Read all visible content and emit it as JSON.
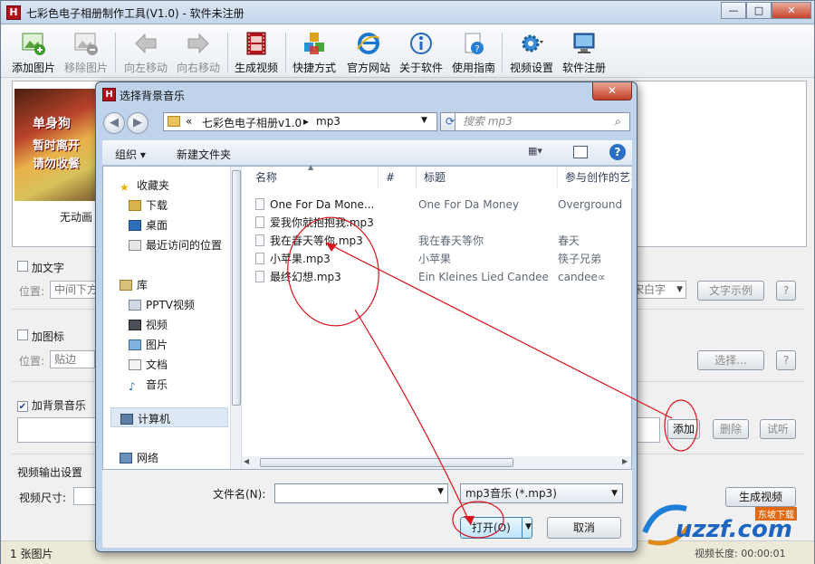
{
  "app": {
    "title": "七彩色电子相册制作工具(V1.0) - 软件未注册",
    "icon_letter": "H",
    "window_buttons": {
      "minimize": "—",
      "maximize": "□",
      "close": "✕"
    }
  },
  "toolbar": {
    "items": [
      {
        "label": "添加图片",
        "icon": "add-image-icon",
        "enabled": true
      },
      {
        "label": "移除图片",
        "icon": "remove-image-icon",
        "enabled": false
      },
      {
        "label": "向左移动",
        "icon": "arrow-left-icon",
        "enabled": false
      },
      {
        "label": "向右移动",
        "icon": "arrow-right-icon",
        "enabled": false
      },
      {
        "label": "生成视频",
        "icon": "film-icon",
        "enabled": true
      },
      {
        "label": "快捷方式",
        "icon": "cubes-icon",
        "enabled": true
      },
      {
        "label": "官方网站",
        "icon": "ie-icon",
        "enabled": true
      },
      {
        "label": "关于软件",
        "icon": "info-icon",
        "enabled": true
      },
      {
        "label": "使用指南",
        "icon": "help-doc-icon",
        "enabled": true
      },
      {
        "label": "视频设置",
        "icon": "gear-icon",
        "enabled": true
      },
      {
        "label": "软件注册",
        "icon": "monitor-icon",
        "enabled": true
      }
    ]
  },
  "photos": {
    "items": [
      {
        "label": "无动画",
        "thumb_text": [
          "单身狗",
          "暂时离开",
          "请勿收餐"
        ]
      }
    ]
  },
  "text_group": {
    "checkbox_label": "加文字",
    "checked": false,
    "position_label": "位置:",
    "position_value": "中间下方",
    "font_value": "宋白字",
    "sample_button": "文字示例",
    "help_button": "?"
  },
  "icon_group": {
    "checkbox_label": "加图标",
    "checked": false,
    "position_label": "位置:",
    "position_value": "贴边",
    "select_button": "选择...",
    "help_button": "?"
  },
  "music_group": {
    "checkbox_label": "加背景音乐",
    "checked": true,
    "add_button": "添加",
    "delete_button": "删除",
    "preview_button": "试听"
  },
  "video_output": {
    "label": "视频输出设置",
    "size_label": "视频尺寸:",
    "generate_button": "生成视频",
    "length_label": "视频长度: 00:00:01"
  },
  "status": {
    "count": "1 张图片"
  },
  "dialog": {
    "title": "选择背景音乐",
    "close": "✕",
    "back": "◀",
    "forward": "▶",
    "breadcrumb": [
      "«",
      "七彩色电子相册v1.0",
      "▸",
      "mp3"
    ],
    "search_placeholder": "搜索 mp3",
    "organize": "组织 ▾",
    "new_folder": "新建文件夹",
    "nav": [
      {
        "label": "收藏夹",
        "icon": "star-icon",
        "indent": 0
      },
      {
        "label": "下载",
        "icon": "download-folder-icon",
        "indent": 1
      },
      {
        "label": "桌面",
        "icon": "desktop-icon",
        "indent": 1
      },
      {
        "label": "最近访问的位置",
        "icon": "recent-places-icon",
        "indent": 1
      },
      {
        "label": "库",
        "icon": "library-icon",
        "indent": 0
      },
      {
        "label": "PPTV视频",
        "icon": "video-folder-icon",
        "indent": 1
      },
      {
        "label": "视频",
        "icon": "video-icon",
        "indent": 1
      },
      {
        "label": "图片",
        "icon": "picture-icon",
        "indent": 1
      },
      {
        "label": "文档",
        "icon": "document-icon",
        "indent": 1
      },
      {
        "label": "音乐",
        "icon": "music-icon",
        "indent": 1
      },
      {
        "label": "计算机",
        "icon": "computer-icon",
        "indent": 0
      },
      {
        "label": "网络",
        "icon": "network-icon",
        "indent": 0
      }
    ],
    "columns": [
      "名称",
      "#",
      "标题",
      "参与创作的艺术"
    ],
    "files": [
      {
        "name": "One For Da Mone...",
        "num": "",
        "title": "One For Da Money",
        "artist": "Overground"
      },
      {
        "name": "爱我你就抱抱我.mp3",
        "num": "",
        "title": "",
        "artist": ""
      },
      {
        "name": "我在春天等你.mp3",
        "num": "",
        "title": "我在春天等你",
        "artist": "春天"
      },
      {
        "name": "小苹果.mp3",
        "num": "",
        "title": "小苹果",
        "artist": "筷子兄弟"
      },
      {
        "name": "最终幻想.mp3",
        "num": "",
        "title": "Ein Kleines Lied Candee",
        "artist": "candee∝"
      }
    ],
    "filename_label": "文件名(N):",
    "filename_value": "",
    "filetype": "mp3音乐 (*.mp3)",
    "open_button": "打开(O)",
    "cancel_button": "取消"
  },
  "watermark": {
    "text": "uzzf.com",
    "badge": "东坡下载"
  },
  "colors": {
    "accent": "#1c5fb8",
    "annotation": "#d9121b",
    "title_bar": "#c4d5ea"
  }
}
